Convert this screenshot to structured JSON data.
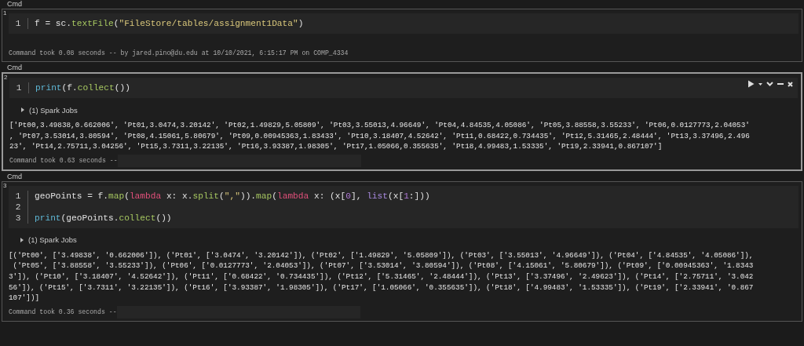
{
  "cells": [
    {
      "label": "Cmd",
      "number": "1",
      "selected": false,
      "code_lines": [
        {
          "number": "1",
          "tokens": [
            {
              "kind": "plain",
              "text": "f = sc."
            },
            {
              "kind": "func",
              "text": "textFile"
            },
            {
              "kind": "plain",
              "text": "("
            },
            {
              "kind": "string",
              "text": "\"FileStore/tables/assignment1Data\""
            },
            {
              "kind": "plain",
              "text": ")"
            }
          ]
        }
      ],
      "footer": "Command took 0.08 seconds -- by jared.pino@du.edu at 10/10/2021, 6:15:17 PM on COMP_4334",
      "footer_redacted": false
    },
    {
      "label": "Cmd",
      "number": "2",
      "selected": true,
      "code_lines": [
        {
          "number": "1",
          "tokens": [
            {
              "kind": "builtin",
              "text": "print"
            },
            {
              "kind": "plain",
              "text": "(f."
            },
            {
              "kind": "func",
              "text": "collect"
            },
            {
              "kind": "plain",
              "text": "())"
            }
          ]
        }
      ],
      "spark_jobs": {
        "label": "(1) Spark Jobs",
        "expanded": false
      },
      "output": [
        "['Pt00,3.49838,0.662006', 'Pt01,3.0474,3.20142', 'Pt02,1.49829,5.05809', 'Pt03,3.55013,4.96649', 'Pt04,4.84535,4.05086', 'Pt05,3.88558,3.55233', 'Pt06,0.0127773,2.04053'",
        ", 'Pt07,3.53014,3.80594', 'Pt08,4.15061,5.80679', 'Pt09,0.00945363,1.83433', 'Pt10,3.18407,4.52642', 'Pt11,0.68422,0.734435', 'Pt12,5.31465,2.48444', 'Pt13,3.37496,2.496",
        "23', 'Pt14,2.75711,3.04256', 'Pt15,3.7311,3.22135', 'Pt16,3.93387,1.98305', 'Pt17,1.05066,0.355635', 'Pt18,4.99483,1.53335', 'Pt19,2.33941,0.867107']"
      ],
      "footer": "Command took 0.63 seconds --",
      "footer_redacted": true
    },
    {
      "label": "Cmd",
      "number": "3",
      "selected": false,
      "code_lines": [
        {
          "number": "1",
          "tokens": [
            {
              "kind": "plain",
              "text": "geoPoints = f."
            },
            {
              "kind": "func",
              "text": "map"
            },
            {
              "kind": "plain",
              "text": "("
            },
            {
              "kind": "keyword",
              "text": "lambda"
            },
            {
              "kind": "plain",
              "text": " x: x."
            },
            {
              "kind": "func",
              "text": "split"
            },
            {
              "kind": "plain",
              "text": "("
            },
            {
              "kind": "string",
              "text": "\",\""
            },
            {
              "kind": "plain",
              "text": "))."
            },
            {
              "kind": "func",
              "text": "map"
            },
            {
              "kind": "plain",
              "text": "("
            },
            {
              "kind": "keyword",
              "text": "lambda"
            },
            {
              "kind": "plain",
              "text": " x: (x["
            },
            {
              "kind": "number",
              "text": "0"
            },
            {
              "kind": "plain",
              "text": "], "
            },
            {
              "kind": "builtin2",
              "text": "list"
            },
            {
              "kind": "plain",
              "text": "(x["
            },
            {
              "kind": "number",
              "text": "1"
            },
            {
              "kind": "plain",
              "text": ":]))"
            }
          ]
        },
        {
          "number": "2"
        },
        {
          "number": "3",
          "tokens": [
            {
              "kind": "builtin",
              "text": "print"
            },
            {
              "kind": "plain",
              "text": "(geoPoints."
            },
            {
              "kind": "func",
              "text": "collect"
            },
            {
              "kind": "plain",
              "text": "())"
            }
          ]
        }
      ],
      "spark_jobs": {
        "label": "(1) Spark Jobs",
        "expanded": false
      },
      "output": [
        "[('Pt00', ['3.49838', '0.662006']), ('Pt01', ['3.0474', '3.20142']), ('Pt02', ['1.49829', '5.05809']), ('Pt03', ['3.55013', '4.96649']), ('Pt04', ['4.84535', '4.05086']),",
        " ('Pt05', ['3.88558', '3.55233']), ('Pt06', ['0.0127773', '2.04053']), ('Pt07', ['3.53014', '3.80594']), ('Pt08', ['4.15061', '5.80679']), ('Pt09', ['0.00945363', '1.8343",
        "3']), ('Pt10', ['3.18407', '4.52642']), ('Pt11', ['0.68422', '0.734435']), ('Pt12', ['5.31465', '2.48444']), ('Pt13', ['3.37496', '2.49623']), ('Pt14', ['2.75711', '3.042",
        "56']), ('Pt15', ['3.7311', '3.22135']), ('Pt16', ['3.93387', '1.98305']), ('Pt17', ['1.05066', '0.355635']), ('Pt18', ['4.99483', '1.53335']), ('Pt19', ['2.33941', '0.867",
        "107'])]"
      ],
      "footer": "Command took 0.36 seconds --",
      "footer_redacted": true
    }
  ]
}
